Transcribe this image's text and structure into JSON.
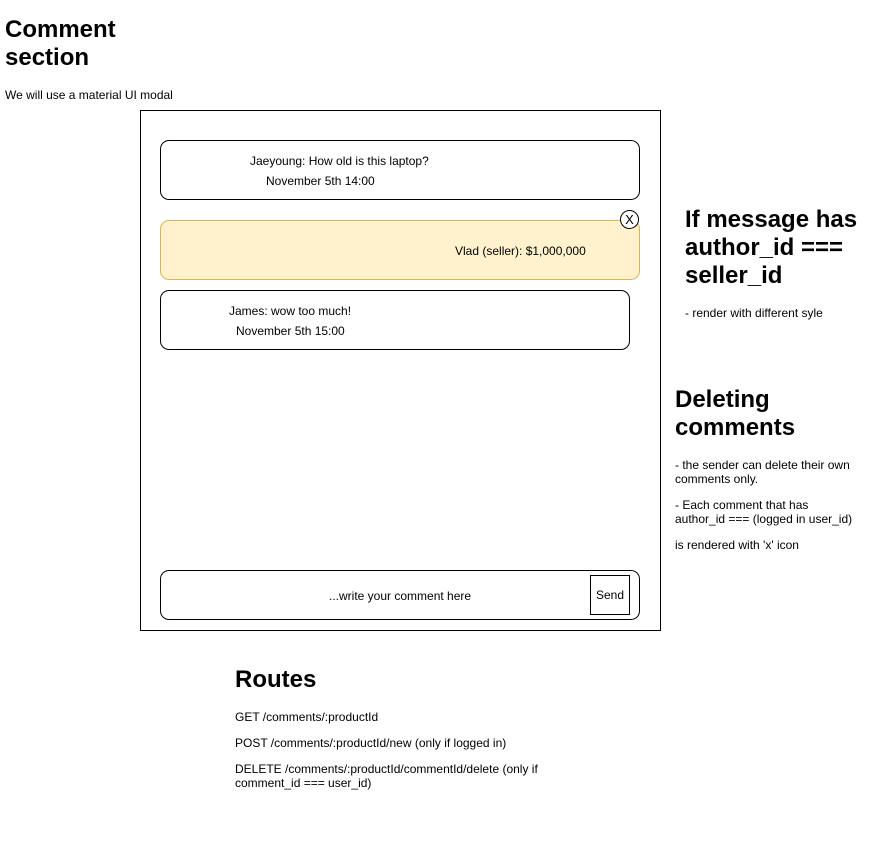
{
  "comment_section": {
    "title_line1": "Comment",
    "title_line2": "section",
    "subtitle": "We will use a material UI modal"
  },
  "modal": {
    "comments": [
      {
        "line1": "Jaeyoung: How old is this laptop?",
        "line2": "November 5th 14:00"
      },
      {
        "line1": "Vlad (seller): $1,000,000",
        "close_label": "X"
      },
      {
        "line1": "James: wow too much!",
        "line2": "November 5th 15:00"
      }
    ],
    "input_placeholder": "...write your comment here",
    "send_label": "Send"
  },
  "seller_note": {
    "title_line1": "If message has",
    "title_line2": "author_id ===",
    "title_line3": "seller_id",
    "text": "- render with different syle"
  },
  "deleting": {
    "title_line1": "Deleting",
    "title_line2": "comments",
    "text1_line1": "- the sender can delete their own",
    "text1_line2": "comments only.",
    "text2_line1": "- Each comment that has",
    "text2_line2": "author_id === (logged in user_id)",
    "text3": "is rendered with 'x' icon"
  },
  "routes": {
    "title": "Routes",
    "get": "GET /comments/:productId",
    "post": "POST /comments/:productId/new (only if logged in)",
    "delete_line1": "DELETE /comments/:productId/commentId/delete (only if",
    "delete_line2": "comment_id === user_id)"
  },
  "colors": {
    "seller_fill": "#fff2cc",
    "seller_border": "#d6b656"
  }
}
